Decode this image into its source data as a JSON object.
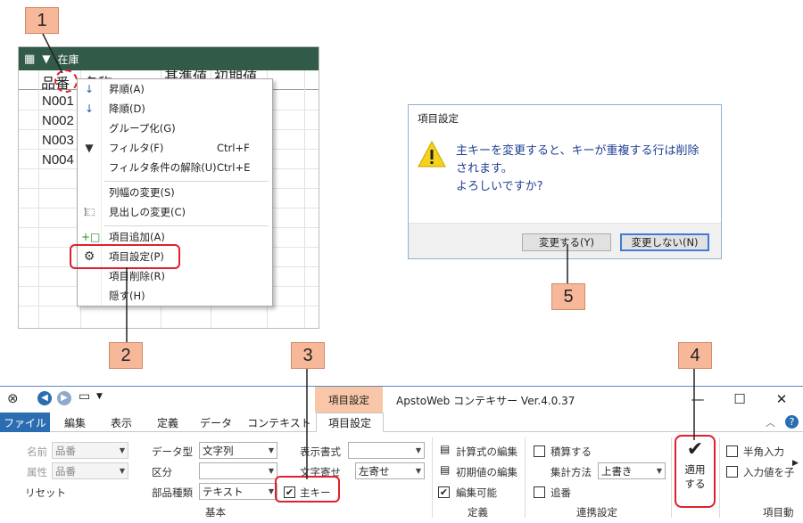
{
  "badges": [
    "1",
    "2",
    "3",
    "4",
    "5"
  ],
  "grid": {
    "toolbar_label": "在庫",
    "columns": [
      "品番",
      "名称",
      "基準値",
      "初期値"
    ],
    "rows": [
      "N001",
      "N002",
      "N003",
      "N004"
    ]
  },
  "context_menu": {
    "items": [
      {
        "label": "昇順(A)",
        "shortcut": "",
        "icon": "sort-asc-icon"
      },
      {
        "label": "降順(D)",
        "shortcut": "",
        "icon": "sort-desc-icon"
      },
      {
        "label": "グループ化(G)",
        "shortcut": "",
        "icon": ""
      },
      {
        "label": "フィルタ(F)",
        "shortcut": "Ctrl+F",
        "icon": "filter-icon"
      },
      {
        "label": "フィルタ条件の解除(U)",
        "shortcut": "Ctrl+E",
        "icon": ""
      },
      {
        "label": "列幅の変更(S)",
        "shortcut": "",
        "icon": ""
      },
      {
        "label": "見出しの変更(C)",
        "shortcut": "",
        "icon": "caption-icon"
      },
      {
        "label": "項目追加(A)",
        "shortcut": "",
        "icon": "add-column-icon"
      },
      {
        "label": "項目設定(P)",
        "shortcut": "",
        "icon": "gear-icon"
      },
      {
        "label": "項目削除(R)",
        "shortcut": "",
        "icon": ""
      },
      {
        "label": "隠す(H)",
        "shortcut": "",
        "icon": ""
      }
    ]
  },
  "dialog": {
    "title": "項目設定",
    "message_line1": "主キーを変更すると、キーが重複する行は削除",
    "message_line2": "されます。",
    "message_line3": "よろしいですか?",
    "yes_button": "変更する(Y)",
    "no_button": "変更しない(N)"
  },
  "window": {
    "context_tab_group": "項目設定",
    "title": "ApstoWeb コンテキサー Ver.4.0.37",
    "controls": [
      "—",
      "☐",
      "✕"
    ],
    "tabs": [
      "ファイル",
      "編集",
      "表示",
      "定義",
      "データ",
      "コンテキスト",
      "項目設定"
    ]
  },
  "ribbon": {
    "name_label": "名前",
    "name_value": "品番",
    "attr_label": "属性",
    "attr_value": "品番",
    "reset_label": "リセット",
    "datatype_label": "データ型",
    "datatype_value": "文字列",
    "category_label": "区分",
    "category_value": "",
    "parttype_label": "部品種類",
    "parttype_value": "テキスト",
    "displayformat_label": "表示書式",
    "displayformat_value": "",
    "align_label": "文字寄せ",
    "align_value": "左寄せ",
    "primarykey_label": "主キー",
    "primarykey_checked": "✔",
    "group_basic": "基本",
    "formula_edit_label": "計算式の編集",
    "initial_edit_label": "初期値の編集",
    "editable_label": "編集可能",
    "editable_checked": "✔",
    "group_definition": "定義",
    "accumulate_label": "積算する",
    "calc_method_label": "集計方法",
    "calc_method_value": "上書き",
    "append_label": "追番",
    "group_link": "連携設定",
    "apply_label_1": "適用",
    "apply_label_2": "する",
    "halfwidth_label": "半角入力",
    "keep_value_label": "入力値を子",
    "group_item": "項目動"
  }
}
